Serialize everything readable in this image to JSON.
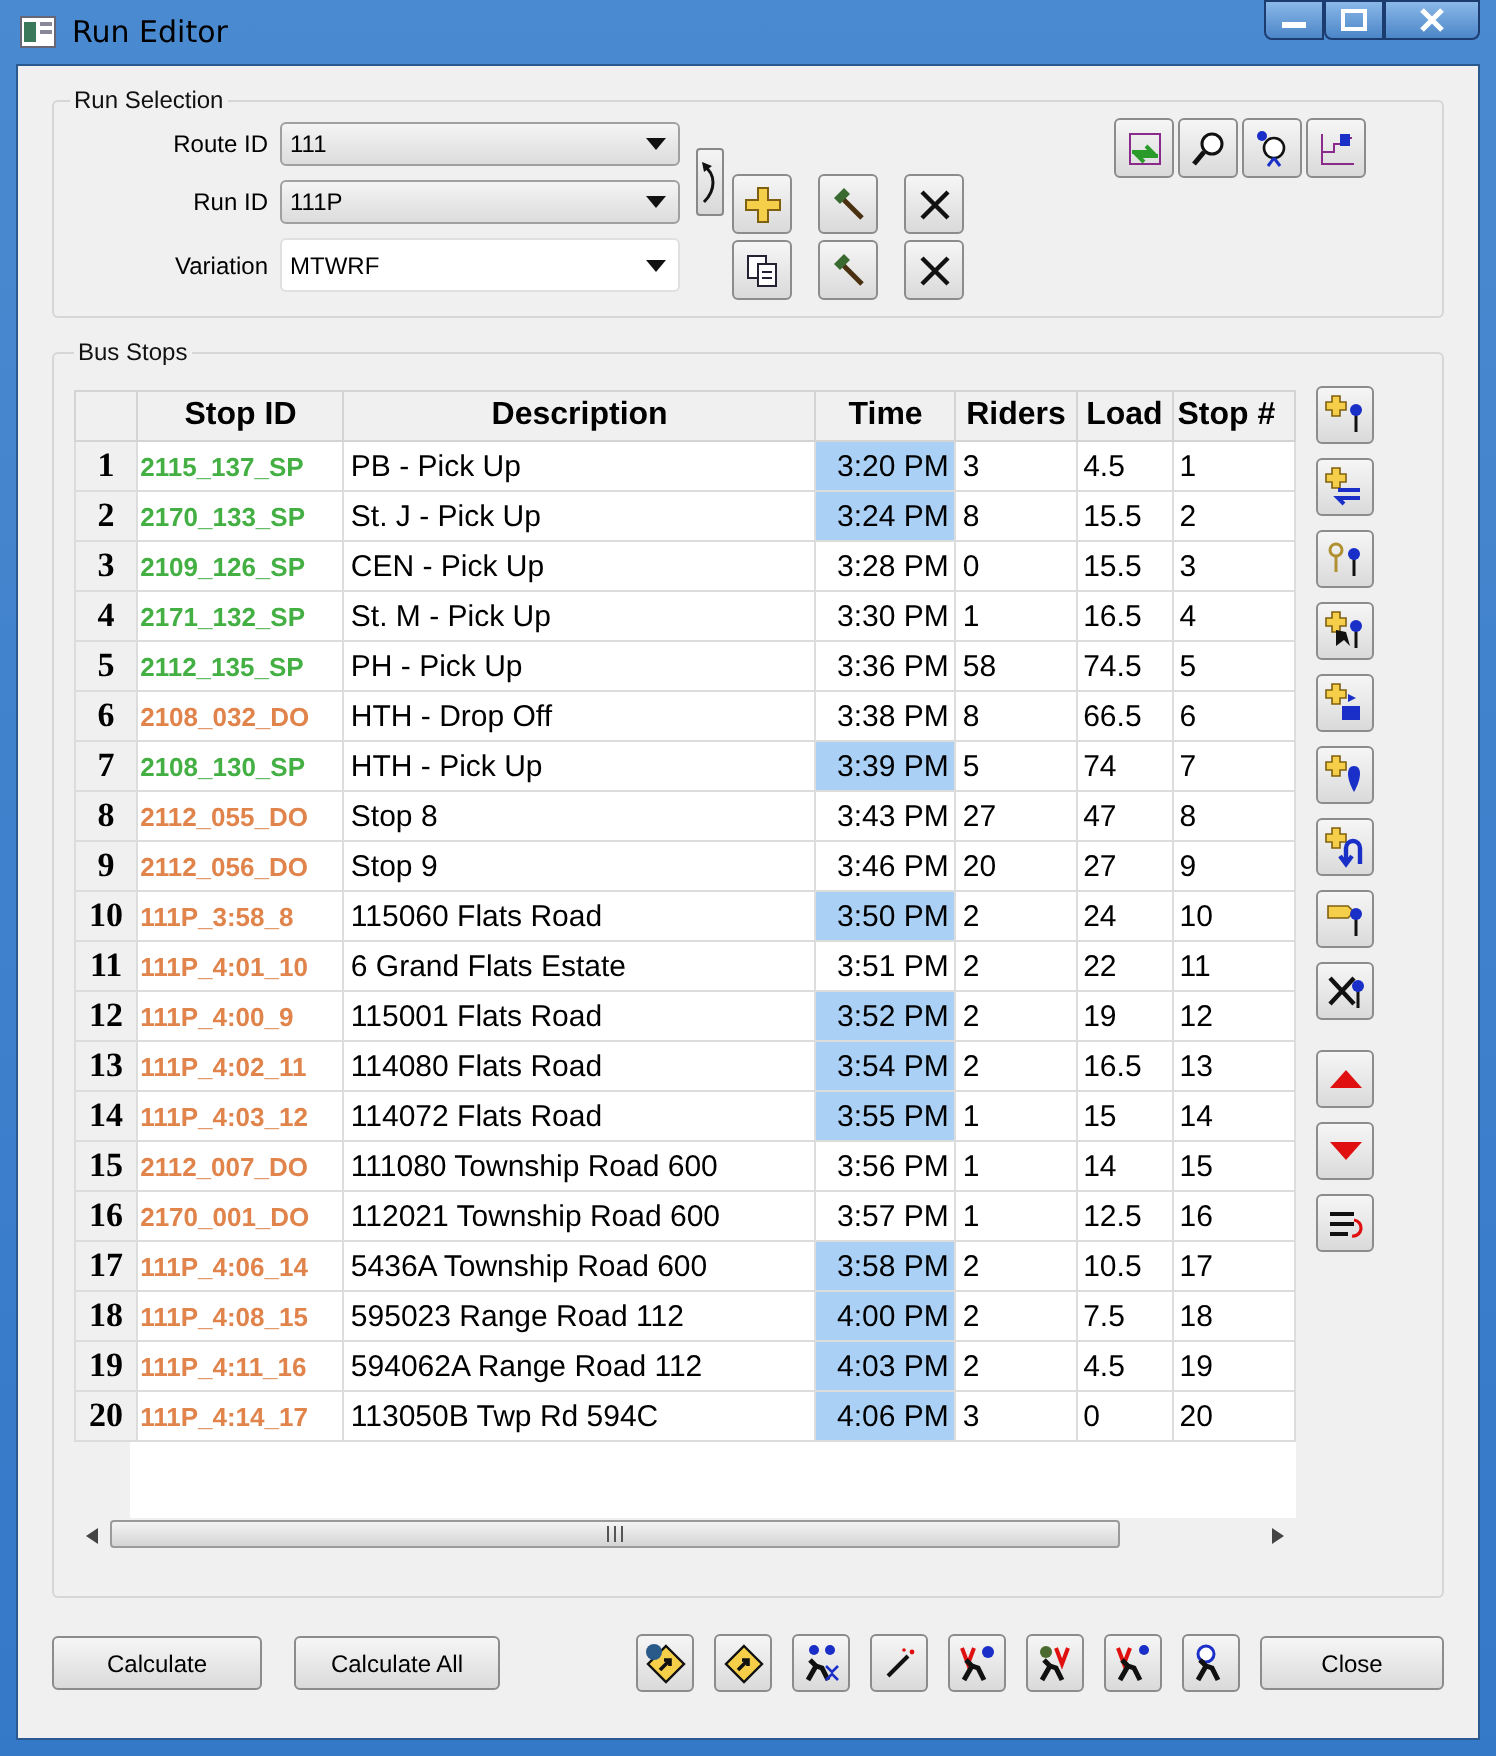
{
  "window": {
    "title": "Run Editor"
  },
  "run_selection": {
    "title": "Run Selection",
    "fields": [
      {
        "label": "Route ID",
        "value": "111",
        "kind": "combo"
      },
      {
        "label": "Run ID",
        "value": "111P",
        "kind": "combo"
      },
      {
        "label": "Variation",
        "value": "MTWRF",
        "kind": "editable"
      }
    ]
  },
  "bus_stops": {
    "title": "Bus Stops",
    "columns": [
      "Stop ID",
      "Description",
      "Time",
      "Riders",
      "Load",
      "Stop #"
    ],
    "rows": [
      {
        "number": "1",
        "stop_id": "2115_137_SP",
        "color": "#44b044",
        "description": "PB - Pick Up",
        "time": "3:20 PM",
        "time_highlighted": true,
        "riders": "3",
        "load": "4.5",
        "stop": "1"
      },
      {
        "number": "2",
        "stop_id": "2170_133_SP",
        "color": "#44b044",
        "description": "St. J - Pick Up",
        "time": "3:24 PM",
        "time_highlighted": true,
        "riders": "8",
        "load": "15.5",
        "stop": "2"
      },
      {
        "number": "3",
        "stop_id": "2109_126_SP",
        "color": "#44b044",
        "description": "CEN - Pick Up",
        "time": "3:28 PM",
        "time_highlighted": false,
        "riders": "0",
        "load": "15.5",
        "stop": "3"
      },
      {
        "number": "4",
        "stop_id": "2171_132_SP",
        "color": "#44b044",
        "description": "St. M - Pick Up",
        "time": "3:30 PM",
        "time_highlighted": false,
        "riders": "1",
        "load": "16.5",
        "stop": "4"
      },
      {
        "number": "5",
        "stop_id": "2112_135_SP",
        "color": "#44b044",
        "description": "PH - Pick Up",
        "time": "3:36 PM",
        "time_highlighted": false,
        "riders": "58",
        "load": "74.5",
        "stop": "5"
      },
      {
        "number": "6",
        "stop_id": "2108_032_DO",
        "color": "#e0844c",
        "description": "HTH - Drop Off",
        "time": "3:38 PM",
        "time_highlighted": false,
        "riders": "8",
        "load": "66.5",
        "stop": "6"
      },
      {
        "number": "7",
        "stop_id": "2108_130_SP",
        "color": "#44b044",
        "description": "HTH - Pick Up",
        "time": "3:39 PM",
        "time_highlighted": true,
        "riders": "5",
        "load": "74",
        "stop": "7"
      },
      {
        "number": "8",
        "stop_id": "2112_055_DO",
        "color": "#e0844c",
        "description": "Stop 8",
        "time": "3:43 PM",
        "time_highlighted": false,
        "riders": "27",
        "load": "47",
        "stop": "8"
      },
      {
        "number": "9",
        "stop_id": "2112_056_DO",
        "color": "#e0844c",
        "description": "Stop 9",
        "time": "3:46 PM",
        "time_highlighted": false,
        "riders": "20",
        "load": "27",
        "stop": "9"
      },
      {
        "number": "10",
        "stop_id": "111P_3:58_8",
        "color": "#e0844c",
        "description": "115060 Flats Road",
        "time": "3:50 PM",
        "time_highlighted": true,
        "riders": "2",
        "load": "24",
        "stop": "10"
      },
      {
        "number": "11",
        "stop_id": "111P_4:01_10",
        "color": "#e0844c",
        "description": "6 Grand Flats Estate",
        "time": "3:51 PM",
        "time_highlighted": false,
        "riders": "2",
        "load": "22",
        "stop": "11"
      },
      {
        "number": "12",
        "stop_id": "111P_4:00_9",
        "color": "#e0844c",
        "description": "115001 Flats Road",
        "time": "3:52 PM",
        "time_highlighted": true,
        "riders": "2",
        "load": "19",
        "stop": "12"
      },
      {
        "number": "13",
        "stop_id": "111P_4:02_11",
        "color": "#e0844c",
        "description": "114080 Flats Road",
        "time": "3:54 PM",
        "time_highlighted": true,
        "riders": "2",
        "load": "16.5",
        "stop": "13"
      },
      {
        "number": "14",
        "stop_id": "111P_4:03_12",
        "color": "#e0844c",
        "description": "114072 Flats Road",
        "time": "3:55 PM",
        "time_highlighted": true,
        "riders": "1",
        "load": "15",
        "stop": "14"
      },
      {
        "number": "15",
        "stop_id": "2112_007_DO",
        "color": "#e0844c",
        "description": "111080 Township Road 600",
        "time": "3:56 PM",
        "time_highlighted": false,
        "riders": "1",
        "load": "14",
        "stop": "15"
      },
      {
        "number": "16",
        "stop_id": "2170_001_DO",
        "color": "#e0844c",
        "description": "112021 Township Road 600",
        "time": "3:57 PM",
        "time_highlighted": false,
        "riders": "1",
        "load": "12.5",
        "stop": "16"
      },
      {
        "number": "17",
        "stop_id": "111P_4:06_14",
        "color": "#e0844c",
        "description": "5436A Township Road 600",
        "time": "3:58 PM",
        "time_highlighted": true,
        "riders": "2",
        "load": "10.5",
        "stop": "17"
      },
      {
        "number": "18",
        "stop_id": "111P_4:08_15",
        "color": "#e0844c",
        "description": "595023 Range Road 112",
        "time": "4:00 PM",
        "time_highlighted": true,
        "riders": "2",
        "load": "7.5",
        "stop": "18"
      },
      {
        "number": "19",
        "stop_id": "111P_4:11_16",
        "color": "#e0844c",
        "description": "594062A Range Road 112",
        "time": "4:03 PM",
        "time_highlighted": true,
        "riders": "2",
        "load": "4.5",
        "stop": "19"
      },
      {
        "number": "20",
        "stop_id": "111P_4:14_17",
        "color": "#e0844c",
        "description": "113050B Twp Rd 594C",
        "time": "4:06 PM",
        "time_highlighted": true,
        "riders": "3",
        "load": "0",
        "stop": "20"
      }
    ]
  },
  "buttons": {
    "calculate": "Calculate",
    "calculate_all": "Calculate All",
    "close": "Close"
  }
}
